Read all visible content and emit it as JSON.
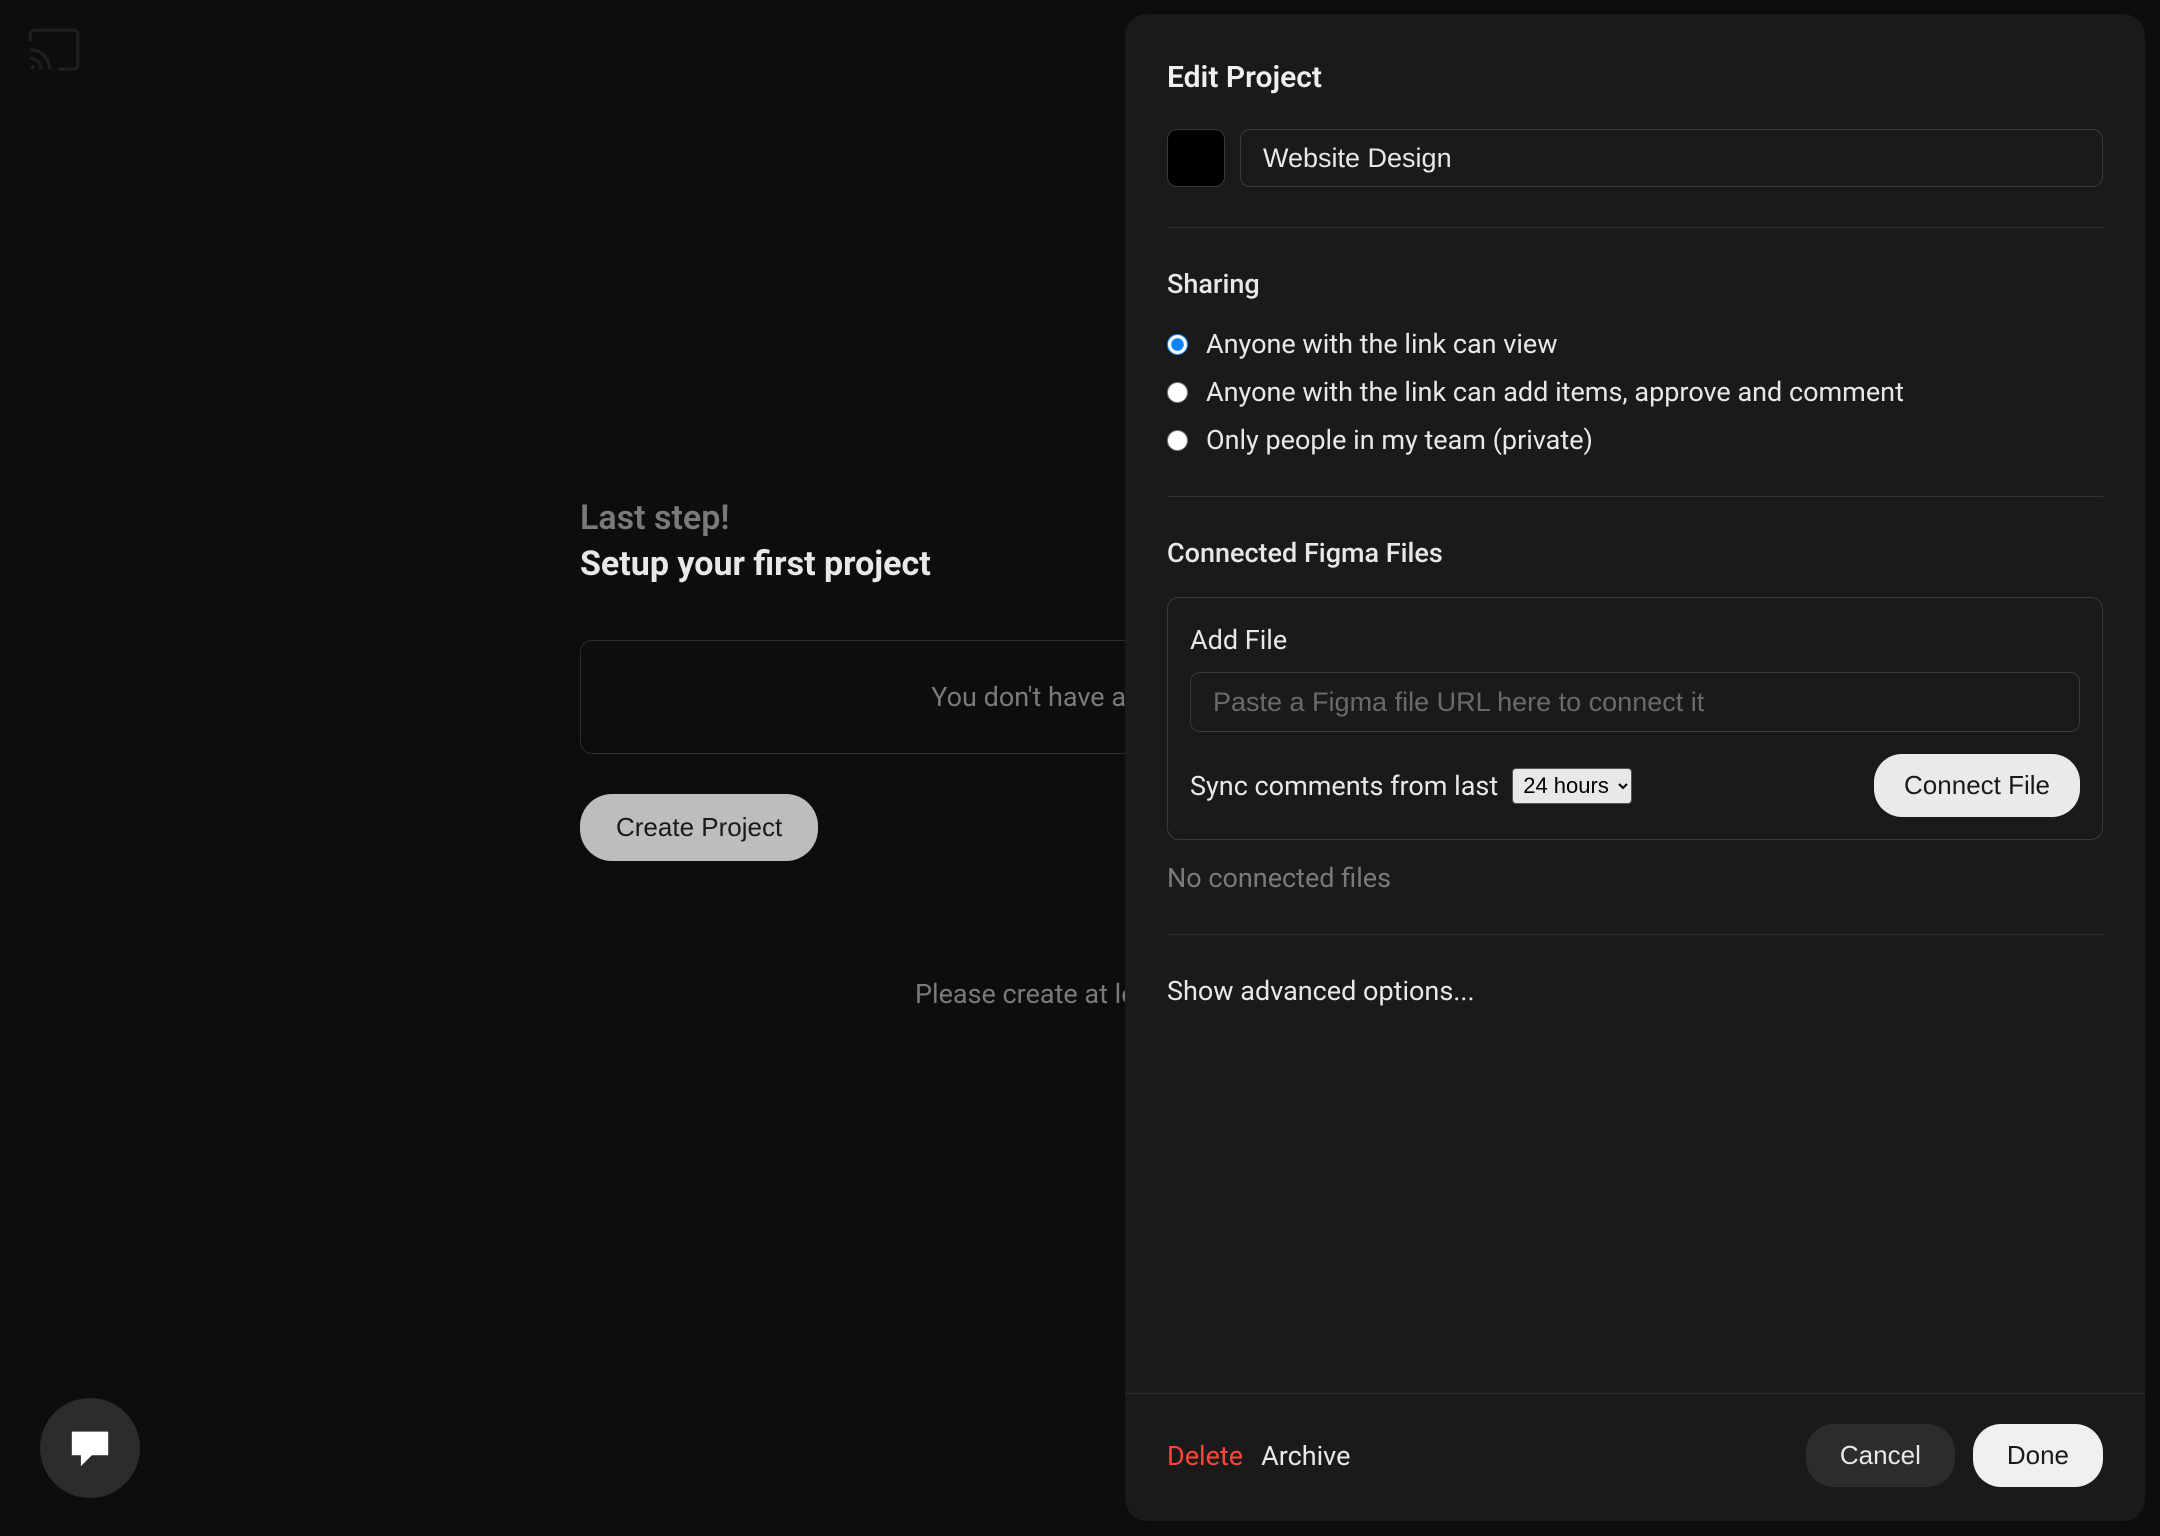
{
  "main": {
    "step_label": "Last step!",
    "step_title": "Setup your first project",
    "empty_text": "You don't have any",
    "create_button": "Create Project",
    "help_text": "Please create at le"
  },
  "panel": {
    "title": "Edit Project",
    "project_name": "Website Design",
    "sharing": {
      "label": "Sharing",
      "options": [
        "Anyone with the link can view",
        "Anyone with the link can add items, approve and comment",
        "Only people in my team (private)"
      ],
      "selected_index": 0
    },
    "figma": {
      "section_label": "Connected Figma Files",
      "add_label": "Add File",
      "placeholder": "Paste a Figma file URL here to connect it",
      "sync_label": "Sync comments from last",
      "sync_value": "24 hours",
      "connect_button": "Connect File",
      "no_files": "No connected files"
    },
    "advanced_label": "Show advanced options...",
    "footer": {
      "delete": "Delete",
      "archive": "Archive",
      "cancel": "Cancel",
      "done": "Done"
    }
  }
}
